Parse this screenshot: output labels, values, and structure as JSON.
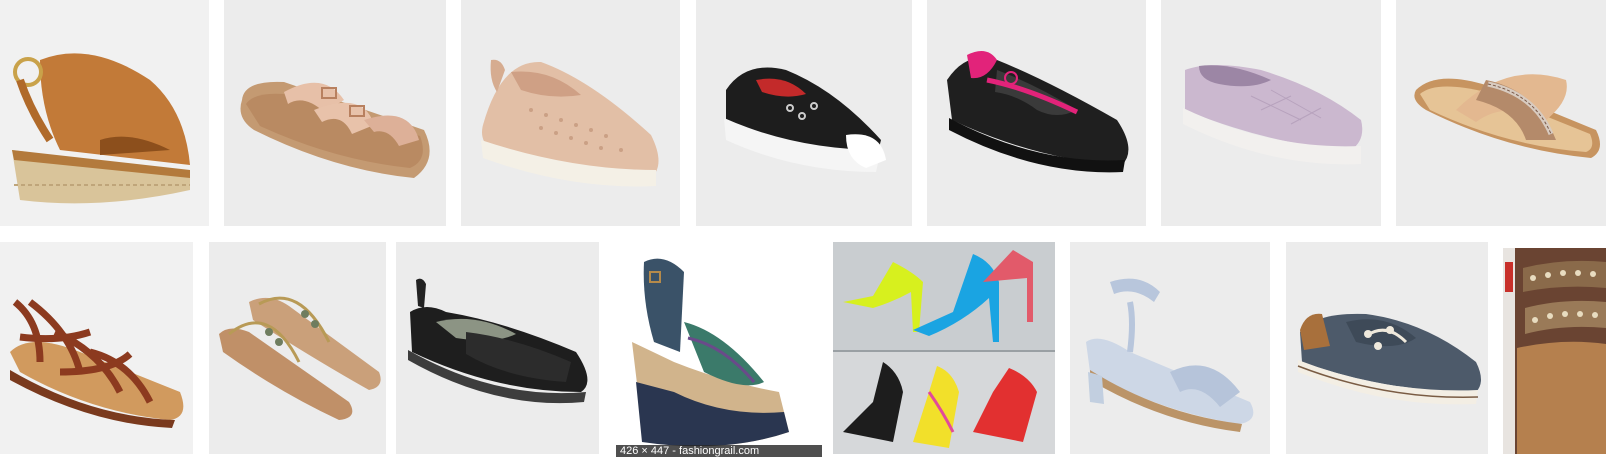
{
  "results": {
    "row1": [
      {
        "name": "tan-wedge-espadrille-sandal"
      },
      {
        "name": "rose-gold-footbed-sandal"
      },
      {
        "name": "blush-perforated-slip-on"
      },
      {
        "name": "black-dot-slip-on-sneaker"
      },
      {
        "name": "black-pink-water-shoe"
      },
      {
        "name": "lavender-quilted-slip-on"
      },
      {
        "name": "tan-crossband-slide"
      }
    ],
    "row2": [
      {
        "name": "cognac-gladiator-sandal"
      },
      {
        "name": "gold-thong-sandal"
      },
      {
        "name": "black-mesh-water-shoe"
      },
      {
        "name": "woven-platform-wedge"
      },
      {
        "name": "heels-collage"
      },
      {
        "name": "light-blue-block-heel-sandal"
      },
      {
        "name": "navy-boat-shoe"
      },
      {
        "name": "beaded-sandal-partial"
      }
    ],
    "hover_caption": "426 × 447 - fashiongrail.com"
  }
}
